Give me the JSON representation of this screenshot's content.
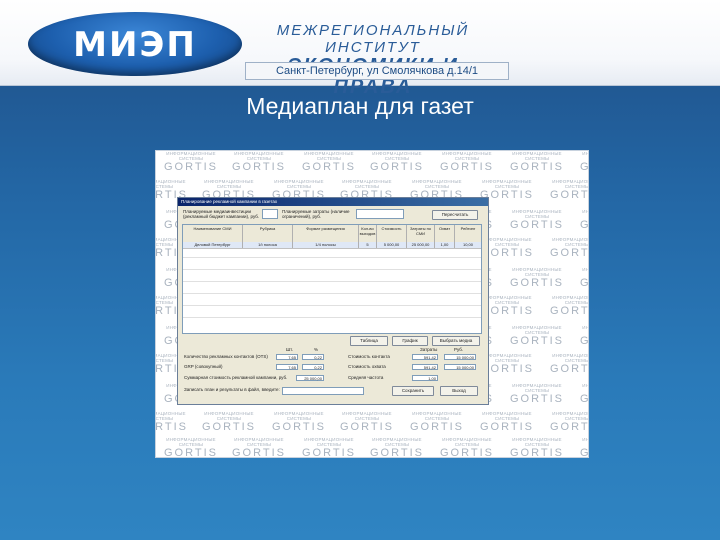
{
  "header": {
    "logo_text": "МИЭП",
    "institute_line1": "МЕЖРЕГИОНАЛЬНЫЙ ИНСТИТУТ",
    "institute_line2": "ЭКОНОМИКИ И ПРАВА",
    "address": "Санкт-Петербург, ул Смолячкова д.14/1"
  },
  "slide": {
    "title": "Медиаплан для газет"
  },
  "watermark": {
    "small": "ИНФОРМАЦИОННЫЕ СИСТЕМЫ",
    "brand": "GORTIS"
  },
  "app": {
    "window_title": "Планирование рекламной кампании в газетах",
    "top_left_label": "Планируемые медиаинвестиции (рекламный бюджет кампании), руб.",
    "top_mid_label": "Планируемые затраты (наличие ограничений), руб.",
    "recalc_button": "Пересчитать",
    "columns": [
      "Наименование СМИ",
      "Рубрика",
      "Формат размещения",
      "Кол-во выходов",
      "Стоимость",
      "Затраты по СМИ",
      "Охват",
      "Рейтинг"
    ],
    "rows": [
      [
        "Деловой Петербург",
        "1ð полоса",
        "1/4 полосы",
        "5",
        "5 000,00",
        "25 000,00",
        "1,00",
        "10,00"
      ]
    ],
    "buttons": {
      "table": "Таблица",
      "chart": "График",
      "select": "Выбрать медиа"
    },
    "summary": {
      "col_pieces": "Шт.",
      "col_pct": "%",
      "col_pieces2": "Затраты",
      "col_rub": "Руб.",
      "rows_left": [
        {
          "label": "Количество рекламных контактов (OTS)",
          "v1": "7,65",
          "v2": "0,22"
        },
        {
          "label": "GRP (совокупный)",
          "v1": "7,65",
          "v2": "0,22"
        }
      ],
      "budget_label": "Суммарная стоимость рекламной кампании, руб.",
      "budget_value": "25 000,00",
      "rows_right": [
        {
          "label": "Стоимость контакта",
          "v1": "591,42",
          "v2": "15 000,00"
        },
        {
          "label": "Стоимость охвата",
          "v1": "591,42",
          "v2": "15 000,00"
        },
        {
          "label": "Средняя частота",
          "v1": "1,00",
          "v2": ""
        }
      ],
      "save_label": "Записать план и результаты в файл, введите:",
      "save_button": "Сохранить",
      "exit_button": "Выход"
    }
  }
}
